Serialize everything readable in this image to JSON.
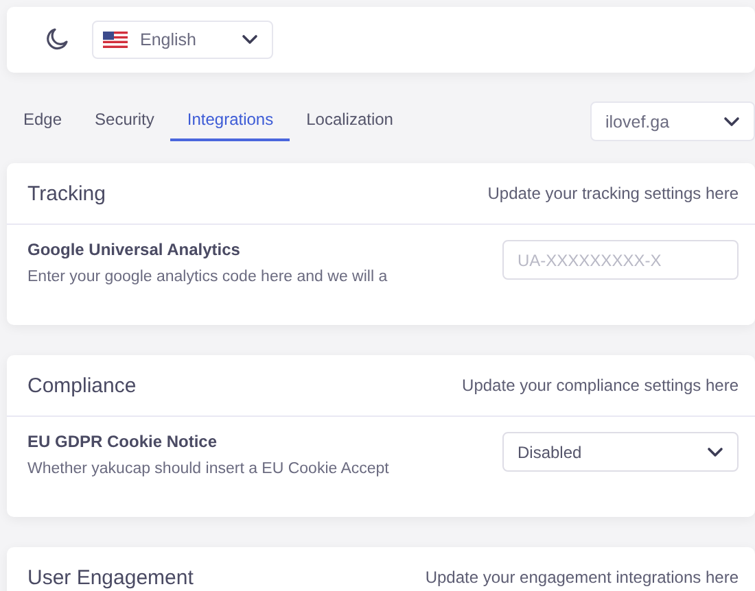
{
  "top_bar": {
    "language_select": {
      "value": "English"
    }
  },
  "tabs": [
    {
      "label": "Edge",
      "selected": false
    },
    {
      "label": "Security",
      "selected": false
    },
    {
      "label": "Integrations",
      "selected": true
    },
    {
      "label": "Localization",
      "selected": false
    }
  ],
  "domain_select": {
    "value": "ilovef.ga"
  },
  "sections": [
    {
      "title": "Tracking",
      "subtitle": "Update your tracking settings here",
      "setting": {
        "label": "Google Universal Analytics",
        "description": "Enter your google analytics code here and we will a",
        "control": {
          "kind": "input",
          "placeholder": "UA-XXXXXXXXX-X"
        }
      }
    },
    {
      "title": "Compliance",
      "subtitle": "Update your compliance settings here",
      "setting": {
        "label": "EU GDPR Cookie Notice",
        "description": "Whether yakucap should insert a EU Cookie Accept",
        "control": {
          "kind": "select",
          "value": "Disabled"
        }
      }
    },
    {
      "title": "User Engagement",
      "subtitle": "Update your engagement integrations here"
    }
  ]
}
